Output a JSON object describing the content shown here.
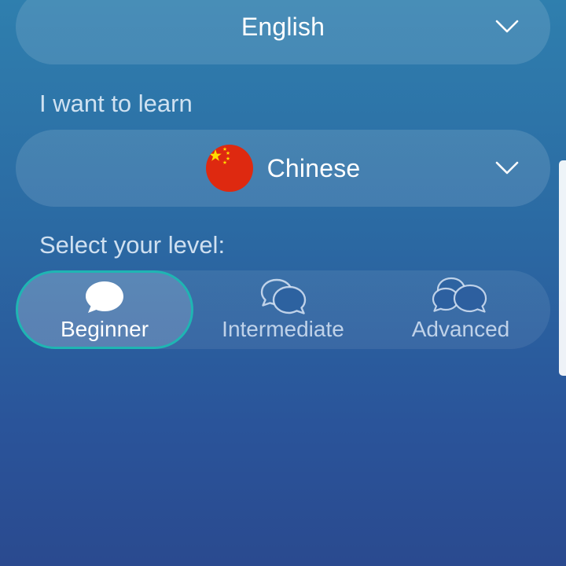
{
  "native_language": {
    "value": "English",
    "icon": "chevron-down-icon"
  },
  "learn_section": {
    "label": "I want to learn"
  },
  "target_language": {
    "value": "Chinese",
    "flag_icon": "china-flag-icon",
    "icon": "chevron-down-icon"
  },
  "level_section": {
    "label": "Select your level:",
    "options": [
      {
        "label": "Beginner",
        "icon": "single-speech-bubble-icon",
        "selected": true
      },
      {
        "label": "Intermediate",
        "icon": "double-speech-bubble-icon",
        "selected": false
      },
      {
        "label": "Advanced",
        "icon": "triple-speech-bubble-icon",
        "selected": false
      }
    ]
  },
  "colors": {
    "accent": "#1fb5b3",
    "flag_red": "#de2910",
    "flag_yellow": "#ffde00"
  }
}
